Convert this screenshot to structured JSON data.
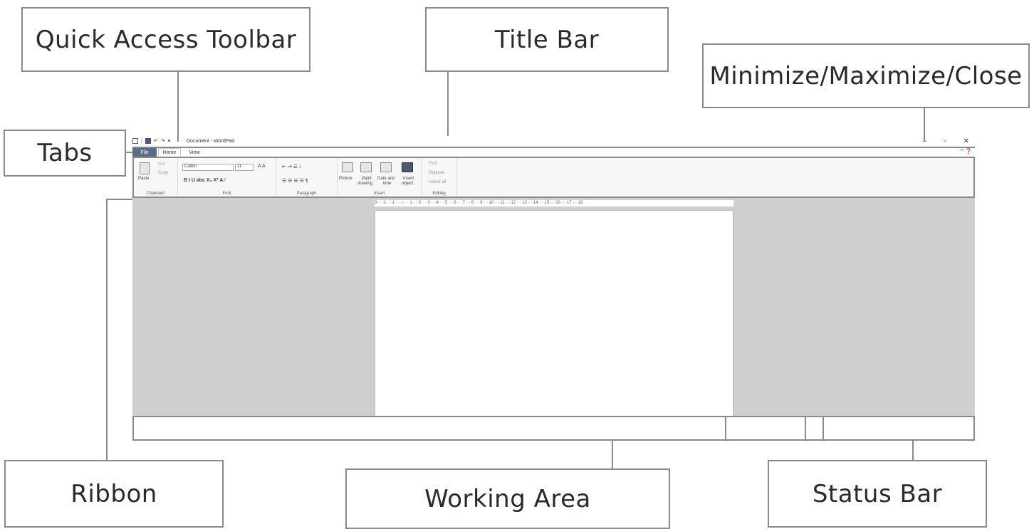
{
  "callouts": {
    "quick_access_toolbar": "Quick Access Toolbar",
    "title_bar": "Title Bar",
    "window_controls": "Minimize/Maximize/Close",
    "tabs": "Tabs",
    "ribbon": "Ribbon",
    "working_area": "Working Area",
    "status_bar": "Status Bar"
  },
  "window": {
    "title": "Document - WordPad",
    "tabs": [
      "File",
      "Home",
      "View"
    ],
    "ribbon": {
      "clipboard": {
        "label": "Clipboard",
        "paste": "Paste",
        "cut": "Cut",
        "copy": "Copy"
      },
      "font": {
        "label": "Font",
        "family": "Calibri",
        "size": "11"
      },
      "paragraph": {
        "label": "Paragraph"
      },
      "insert": {
        "label": "Insert",
        "picture": "Picture",
        "paint1": "Paint",
        "paint2": "drawing",
        "date1": "Date and",
        "date2": "time",
        "insert1": "Insert",
        "insert2": "object"
      },
      "editing": {
        "label": "Editing",
        "find": "Find",
        "replace": "Replace",
        "select_all": "Select all"
      }
    },
    "ruler": "3 · · 2 · · 1 · · ⌂ · · 1 · · 2 · · 3 · · 4 · · 5 · · 6 · · 7 · · 8 · · 9 · · 10 · · 11 · · 12 · · 13 · · 14 · · 15 · · 16 · · 17 · · 18"
  },
  "colors": {
    "frame": "#8a8a8a",
    "workspace": "#cfcfcf",
    "file_tab": "#5a6d86"
  }
}
